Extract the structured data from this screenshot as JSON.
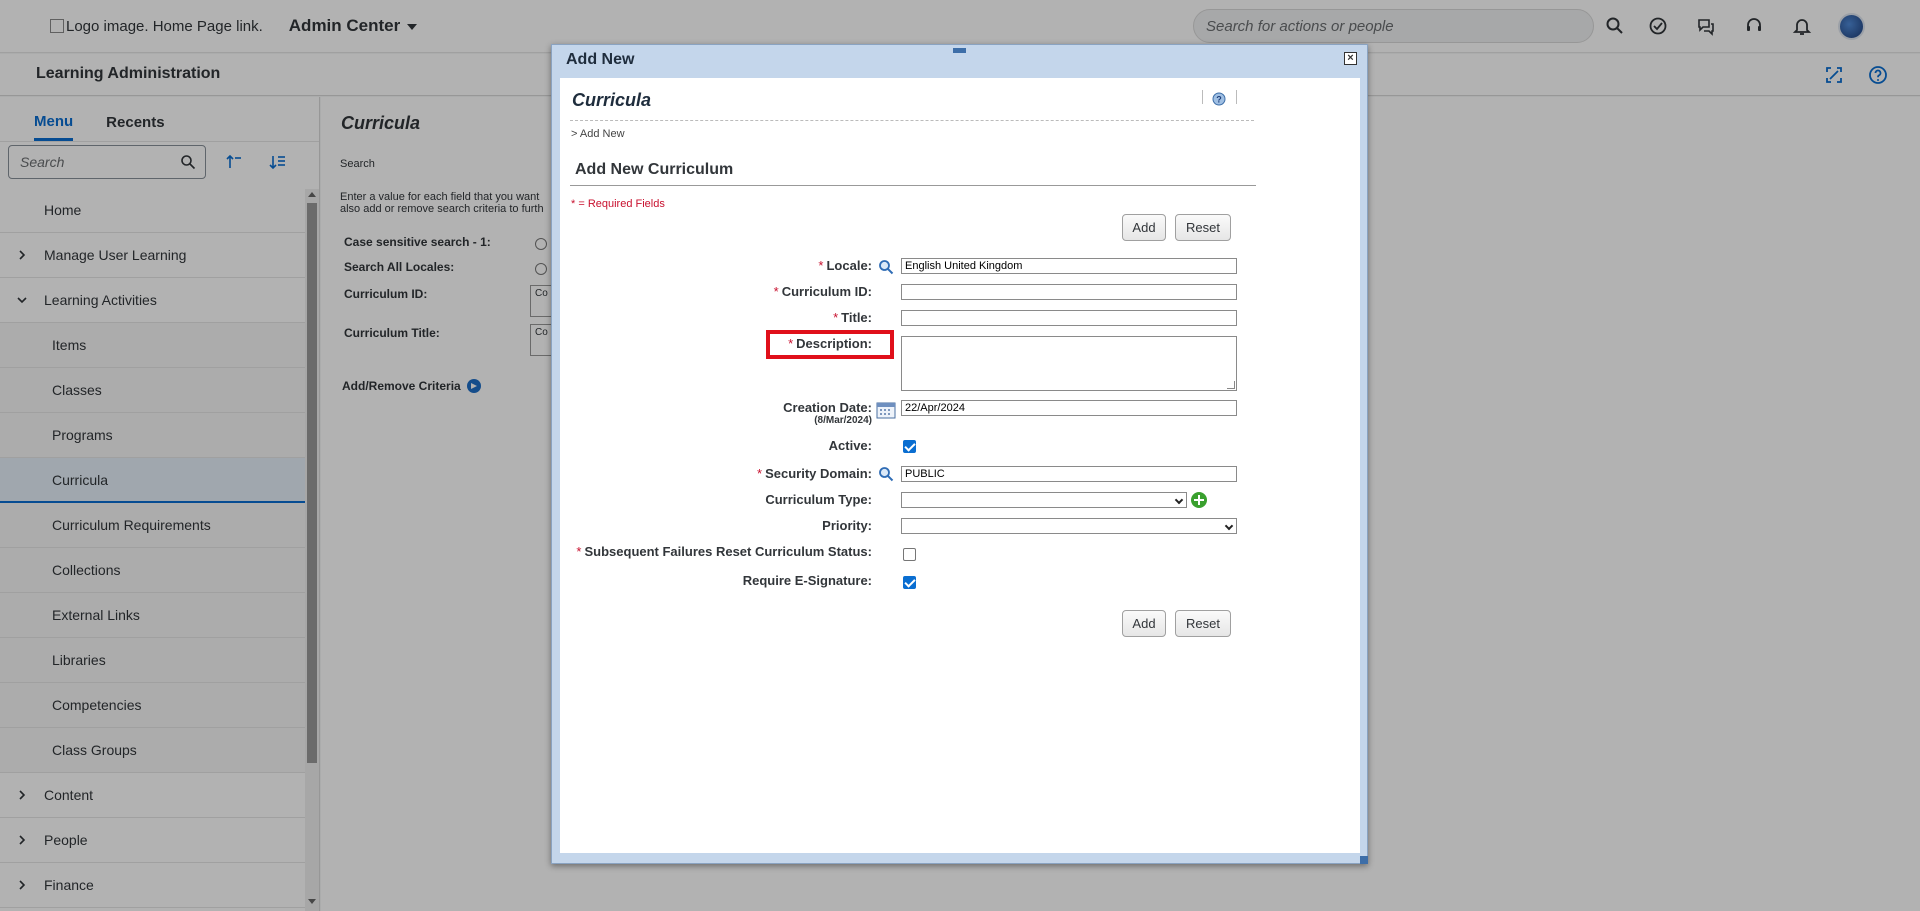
{
  "shell": {
    "logo_alt": "Logo image. Home Page link.",
    "app_title": "Admin Center",
    "search_placeholder": "Search for actions or people"
  },
  "subheader": {
    "title": "Learning Administration"
  },
  "sidebar": {
    "tabs": [
      "Menu",
      "Recents"
    ],
    "search_placeholder": "Search",
    "items": [
      {
        "label": "Home",
        "type": "top"
      },
      {
        "label": "Manage User Learning",
        "type": "collapsed"
      },
      {
        "label": "Learning Activities",
        "type": "expanded"
      },
      {
        "label": "Items",
        "type": "child"
      },
      {
        "label": "Classes",
        "type": "child"
      },
      {
        "label": "Programs",
        "type": "child"
      },
      {
        "label": "Curricula",
        "type": "child-selected"
      },
      {
        "label": "Curriculum Requirements",
        "type": "child"
      },
      {
        "label": "Collections",
        "type": "child"
      },
      {
        "label": "External Links",
        "type": "child"
      },
      {
        "label": "Libraries",
        "type": "child"
      },
      {
        "label": "Competencies",
        "type": "child"
      },
      {
        "label": "Class Groups",
        "type": "child"
      },
      {
        "label": "Content",
        "type": "collapsed"
      },
      {
        "label": "People",
        "type": "collapsed"
      },
      {
        "label": "Finance",
        "type": "collapsed"
      }
    ]
  },
  "main": {
    "title": "Curricula",
    "search_label": "Search",
    "help_line1": "Enter a value for each field that you want",
    "help_line2": "also add or remove search criteria to furth",
    "case_sensitive_label": "Case sensitive search - 1:",
    "search_all_locales_label": "Search All Locales:",
    "curriculum_id_label": "Curriculum ID:",
    "curriculum_title_label": "Curriculum Title:",
    "crit_box_text": "Co",
    "add_remove_label": "Add/Remove Criteria"
  },
  "dialog": {
    "title": "Add New",
    "close_label": "×",
    "page_title": "Curricula",
    "breadcrumb": "> Add New",
    "section_title": "Add New Curriculum",
    "required_note": "* = Required Fields",
    "add_label": "Add",
    "reset_label": "Reset",
    "required_marker": "*",
    "fields": {
      "locale": {
        "label": "Locale:",
        "value": "English United Kingdom"
      },
      "curriculum_id": {
        "label": "Curriculum ID:",
        "value": ""
      },
      "title": {
        "label": "Title:",
        "value": ""
      },
      "description": {
        "label": "Description:",
        "value": ""
      },
      "creation_date": {
        "label": "Creation Date:",
        "hint": "(8/Mar/2024)",
        "value": "22/Apr/2024"
      },
      "active": {
        "label": "Active:",
        "checked": true
      },
      "security_domain": {
        "label": "Security Domain:",
        "value": "PUBLIC"
      },
      "curriculum_type": {
        "label": "Curriculum Type:",
        "value": ""
      },
      "priority": {
        "label": "Priority:",
        "value": ""
      },
      "subsequent_failures": {
        "label": "Subsequent Failures Reset Curriculum Status:",
        "checked": false
      },
      "require_esignature": {
        "label": "Require E-Signature:",
        "checked": true
      }
    }
  },
  "colors": {
    "accent": "#0a6ed1",
    "required": "#c8102e",
    "highlight": "#e0101a",
    "dialog_frame": "#c4d6eb"
  }
}
